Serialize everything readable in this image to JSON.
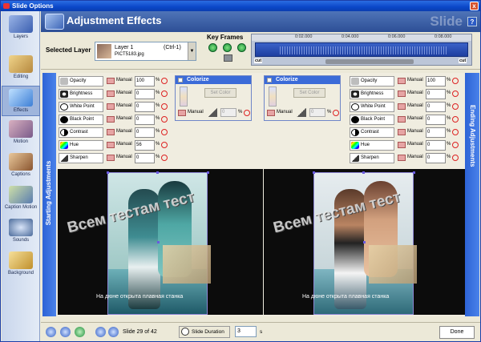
{
  "window": {
    "title": "Slide Options",
    "close_label": "x"
  },
  "header": {
    "title": "Adjustment Effects",
    "brand": "Slide",
    "help": "?"
  },
  "sidebar": {
    "items": [
      {
        "label": "Layers",
        "color": "#3b5fb0"
      },
      {
        "label": "Editing",
        "color": "#b6893f"
      },
      {
        "label": "Effects",
        "color": "#3d7fd6"
      },
      {
        "label": "Motion",
        "color": "#7a5b8a"
      },
      {
        "label": "Captions",
        "color": "#8a5530"
      },
      {
        "label": "Caption Motion",
        "color": "#5a7db0"
      },
      {
        "label": "Sounds",
        "color": "#4a6a9a"
      },
      {
        "label": "Background",
        "color": "#c0902c"
      }
    ]
  },
  "toolbar": {
    "selected_layer_label": "Selected Layer",
    "layer_name": "Layer  1",
    "layer_shortcut": "(Ctrl-1)",
    "layer_file": "PICT5183.jpg",
    "key_frames_label": "Key Frames",
    "ruler": [
      "0:02.000",
      "0:04.000",
      "0:06.000",
      "0:08.000"
    ],
    "cut_left": "cut",
    "cut_right": "cut"
  },
  "starting": {
    "tab_label": "Starting Adjustments",
    "adjustments": [
      {
        "name": "Opacity",
        "manual": "Manual",
        "value": "100",
        "unit": "%",
        "color": "#bdbdbd"
      },
      {
        "name": "Brightness",
        "manual": "Manual",
        "value": "0",
        "unit": "%",
        "color": "#222"
      },
      {
        "name": "White Point",
        "manual": "Manual",
        "value": "0",
        "unit": "%",
        "color": "#fff"
      },
      {
        "name": "Black Point",
        "manual": "Manual",
        "value": "0",
        "unit": "%",
        "color": "#000"
      },
      {
        "name": "Contrast",
        "manual": "Manual",
        "value": "0",
        "unit": "%",
        "color": "#666"
      },
      {
        "name": "Hue",
        "manual": "Manual",
        "value": "56",
        "unit": "%",
        "color": "#e0a020"
      },
      {
        "name": "Sharpen",
        "manual": "Manual",
        "value": "0",
        "unit": "%",
        "color": "#333"
      }
    ],
    "colorize": {
      "title": "Colorize",
      "set_color": "Set Color",
      "manual": "Manual",
      "value": "0",
      "unit": "%"
    }
  },
  "ending": {
    "tab_label": "Ending Adjustments",
    "adjustments": [
      {
        "name": "Opacity",
        "manual": "Manual",
        "value": "100",
        "unit": "%",
        "color": "#bdbdbd"
      },
      {
        "name": "Brightness",
        "manual": "Manual",
        "value": "0",
        "unit": "%",
        "color": "#222"
      },
      {
        "name": "White Point",
        "manual": "Manual",
        "value": "0",
        "unit": "%",
        "color": "#fff"
      },
      {
        "name": "Black Point",
        "manual": "Manual",
        "value": "0",
        "unit": "%",
        "color": "#000"
      },
      {
        "name": "Contrast",
        "manual": "Manual",
        "value": "0",
        "unit": "%",
        "color": "#666"
      },
      {
        "name": "Hue",
        "manual": "Manual",
        "value": "0",
        "unit": "%",
        "color": "#e0a020"
      },
      {
        "name": "Sharpen",
        "manual": "Manual",
        "value": "0",
        "unit": "%",
        "color": "#333"
      }
    ],
    "colorize": {
      "title": "Colorize",
      "set_color": "Set Color",
      "manual": "Manual",
      "value": "0",
      "unit": "%"
    }
  },
  "preview": {
    "watermark": "Всем тестам тест",
    "caption": "На дюне открыта плавная станка"
  },
  "bottom": {
    "slide_text": "Slide 29 of 42",
    "duration_label": "Slide Duration",
    "duration_value": "3",
    "duration_unit": "s",
    "done": "Done"
  }
}
